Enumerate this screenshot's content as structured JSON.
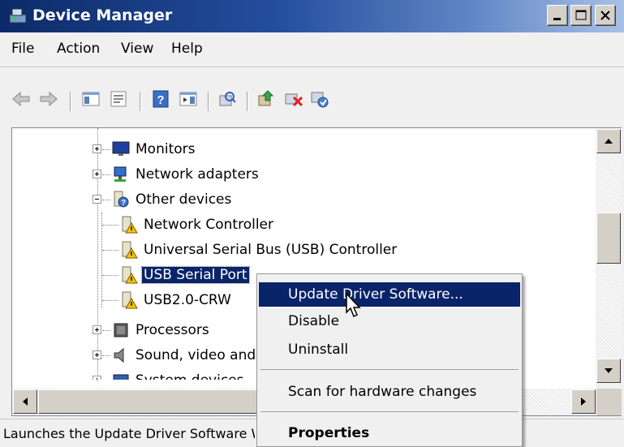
{
  "window": {
    "title": "Device Manager"
  },
  "menu": [
    "File",
    "Action",
    "View",
    "Help"
  ],
  "toolbar": {
    "icons": [
      "back-arrow-icon",
      "forward-arrow-icon",
      "show-hide-tree-icon",
      "properties-icon",
      "help-icon",
      "action-pane-icon",
      "scan-hardware-icon",
      "update-driver-icon",
      "uninstall-icon",
      "enable-device-icon"
    ]
  },
  "tree": {
    "monitors": "Monitors",
    "network_adapters": "Network adapters",
    "other_devices": "Other devices",
    "network_controller": "Network Controller",
    "usb_controller": "Universal Serial Bus (USB) Controller",
    "usb_serial_port": "USB Serial Port",
    "usb2_crw": "USB2.0-CRW",
    "processors": "Processors",
    "sound": "Sound, video and",
    "system_devices": "System devices"
  },
  "context_menu": {
    "update_driver": "Update Driver Software...",
    "disable": "Disable",
    "uninstall": "Uninstall",
    "scan": "Scan for hardware changes",
    "properties": "Properties"
  },
  "status": {
    "text": "Launches the Update Driver Software Wizard for the selected device."
  },
  "colors": {
    "selection": "#0a246a",
    "titlebar": "#0c2a68"
  }
}
